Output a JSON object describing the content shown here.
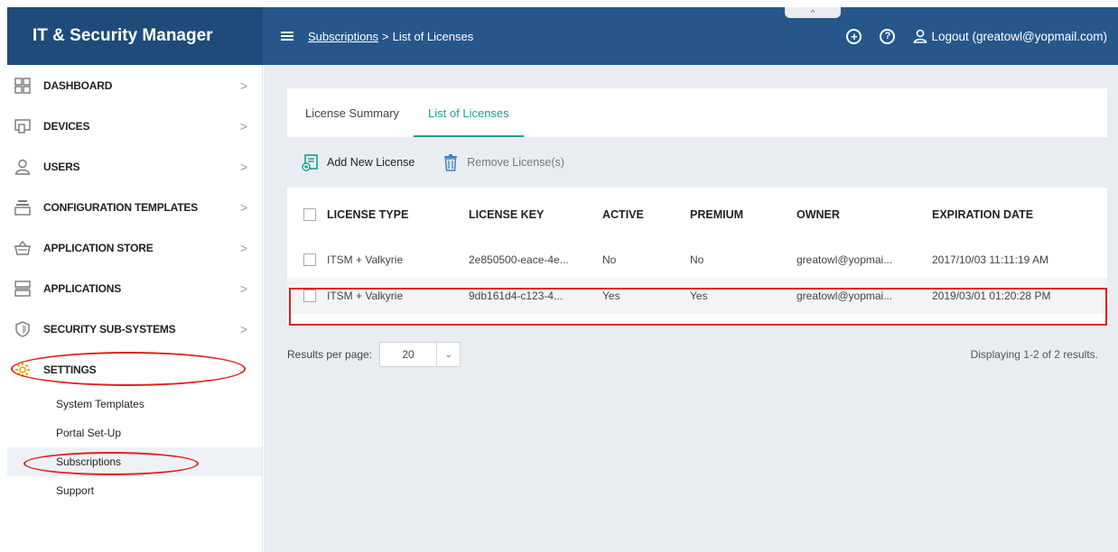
{
  "app": {
    "title": "IT & Security Manager"
  },
  "header": {
    "breadcrumb": {
      "parent": "Subscriptions",
      "separator": ">",
      "current": "List of Licenses"
    },
    "collapse_glyph": "^",
    "add_glyph": "+",
    "help_glyph": "?",
    "logout_label": "Logout (greatowl@yopmail.com)"
  },
  "sidebar": {
    "items": [
      {
        "label": "DASHBOARD",
        "icon": "dashboard-grid-icon"
      },
      {
        "label": "DEVICES",
        "icon": "devices-icon"
      },
      {
        "label": "USERS",
        "icon": "user-icon"
      },
      {
        "label": "CONFIGURATION TEMPLATES",
        "icon": "template-stack-icon"
      },
      {
        "label": "APPLICATION STORE",
        "icon": "basket-icon"
      },
      {
        "label": "APPLICATIONS",
        "icon": "applications-icon"
      },
      {
        "label": "SECURITY SUB-SYSTEMS",
        "icon": "shield-icon"
      },
      {
        "label": "SETTINGS",
        "icon": "gear-icon"
      }
    ],
    "chevron": ">",
    "settings_subitems": [
      {
        "label": "System Templates"
      },
      {
        "label": "Portal Set-Up"
      },
      {
        "label": "Subscriptions"
      },
      {
        "label": "Support"
      }
    ]
  },
  "tabs": [
    {
      "label": "License Summary"
    },
    {
      "label": "List of Licenses"
    }
  ],
  "toolbar": {
    "add_label": "Add New License",
    "remove_label": "Remove License(s)"
  },
  "table": {
    "headers": [
      "LICENSE TYPE",
      "LICENSE KEY",
      "ACTIVE",
      "PREMIUM",
      "OWNER",
      "EXPIRATION DATE"
    ],
    "rows": [
      [
        "ITSM + Valkyrie",
        "2e850500-eace-4e...",
        "No",
        "No",
        "greatowl@yopmai...",
        "2017/10/03 11:11:19 AM"
      ],
      [
        "ITSM + Valkyrie",
        "9db161d4-c123-4...",
        "Yes",
        "Yes",
        "greatowl@yopmai...",
        "2019/03/01 01:20:28 PM"
      ]
    ]
  },
  "pagination": {
    "per_page_label": "Results per page:",
    "per_page_value": "20",
    "summary": "Displaying 1-2 of 2 results."
  },
  "colors": {
    "sidebar_header": "#1e4b7a",
    "topbar": "#27578a",
    "accent": "#1ba08d",
    "annotation": "#e02020"
  }
}
